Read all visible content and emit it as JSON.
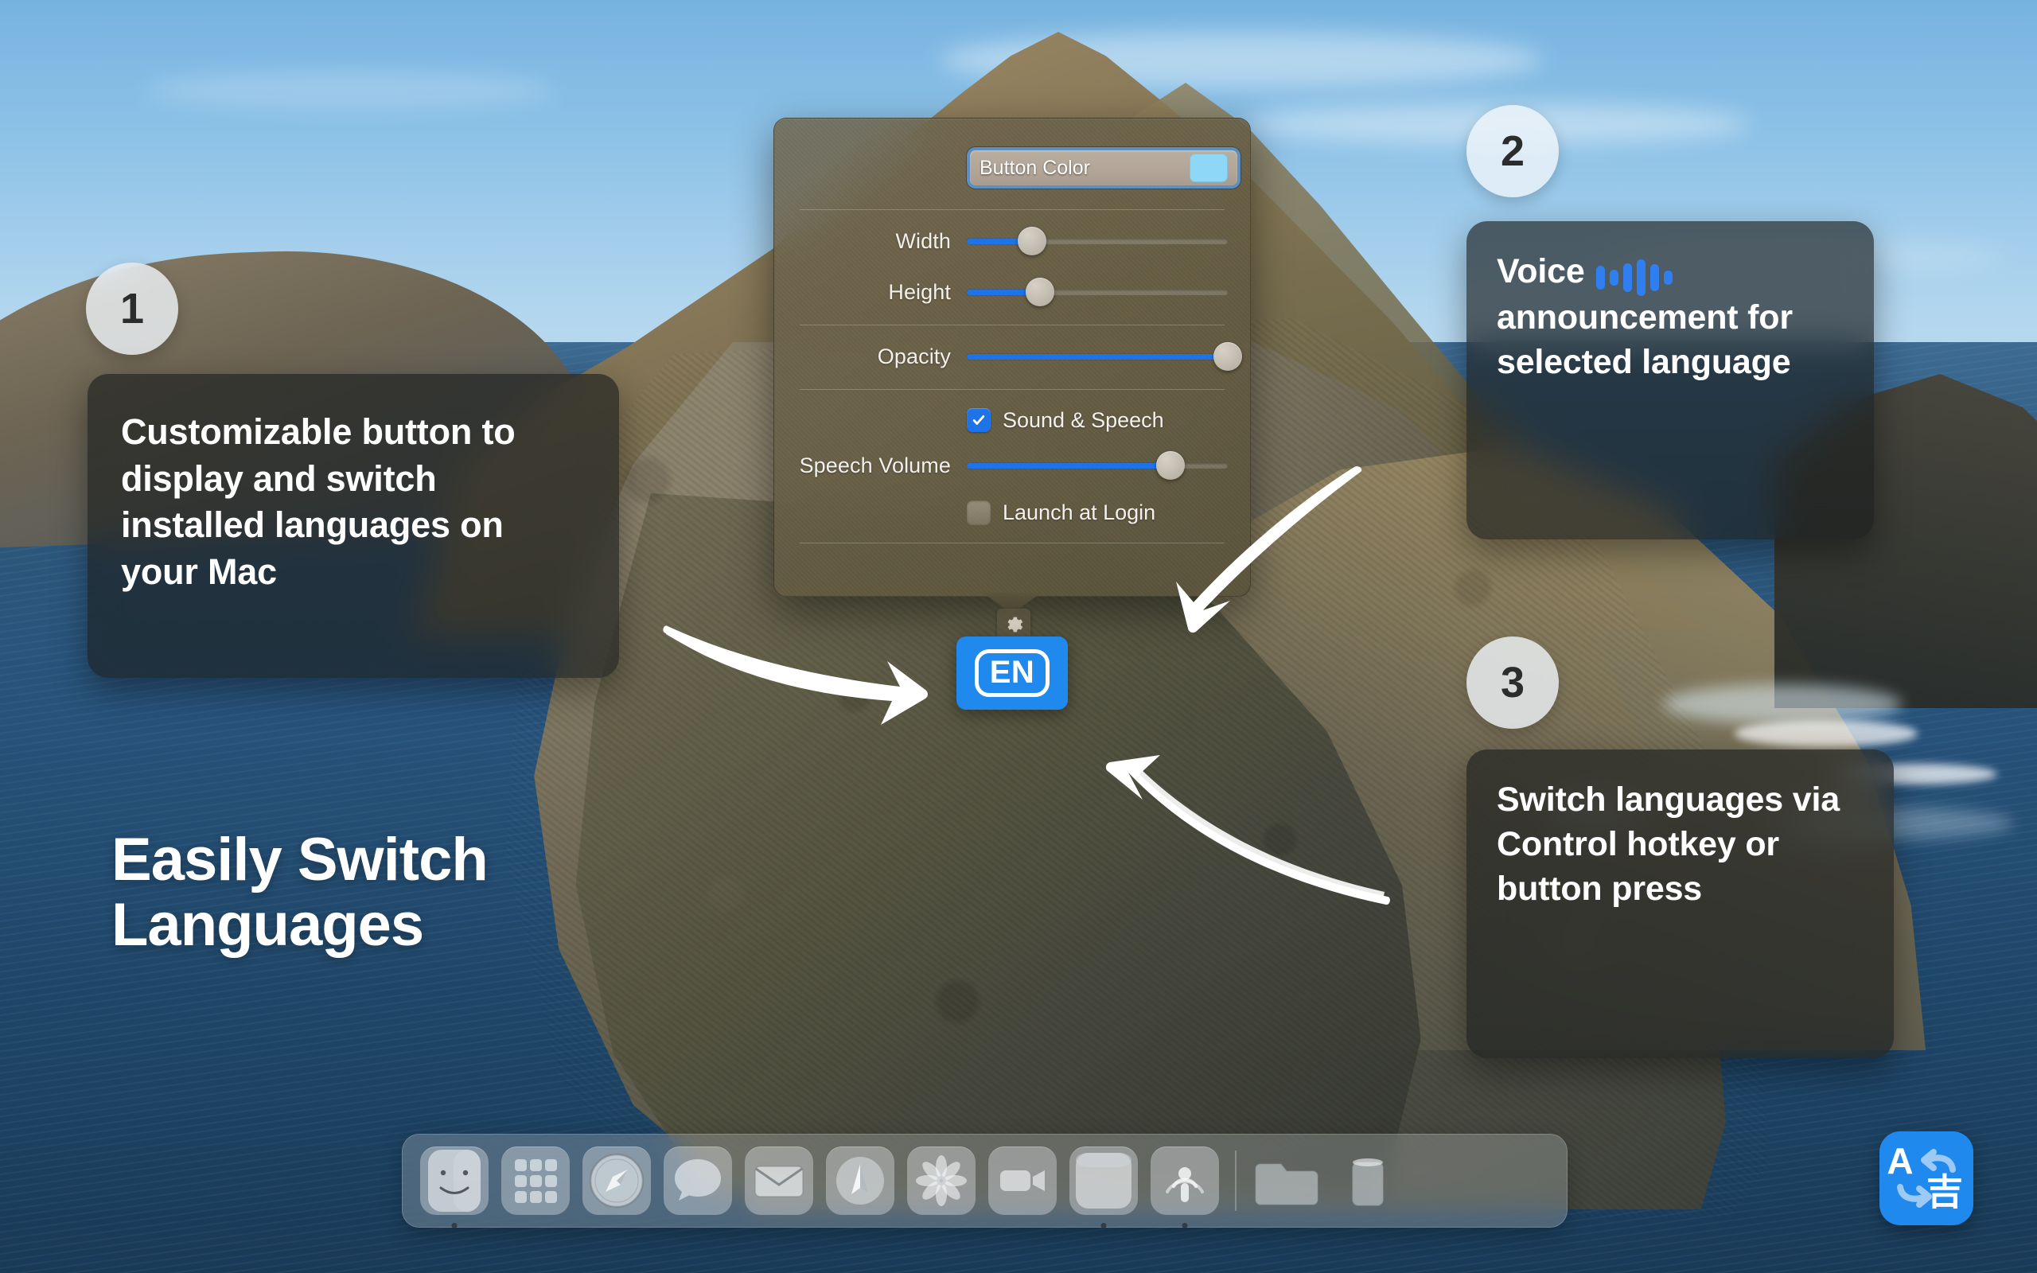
{
  "headline": {
    "line1": "Easily Switch",
    "line2": "Languages"
  },
  "settings_panel": {
    "color_row": {
      "label": "Button Color",
      "swatch_hex": "#8FD7F7",
      "focus_ring_hex": "#5B90C4"
    },
    "sliders": [
      {
        "label": "Width",
        "value_pct": 25
      },
      {
        "label": "Height",
        "value_pct": 28
      },
      {
        "label": "Opacity",
        "value_pct": 100
      },
      {
        "label": "Speech Volume",
        "value_pct": 78
      }
    ],
    "checkboxes": [
      {
        "label": "Sound & Speech",
        "checked": true
      },
      {
        "label": "Launch at Login",
        "checked": false
      }
    ],
    "gear_icon": "gear-icon",
    "accent_hex": "#1F73E8"
  },
  "menu_button": {
    "label": "EN",
    "background_hex": "#2089ED"
  },
  "app_icon": {
    "latin_glyph": "A",
    "cjk_glyph": "吉",
    "background_hex": "#2089ED"
  },
  "callouts": [
    {
      "number": "1",
      "text": "Customizable button to display and switch installed languages on your Mac"
    },
    {
      "number": "2",
      "text_before_icon": "Voice",
      "icon": "voice-waveform-icon",
      "text_after_icon": "announcement for selected language",
      "icon_hex": "#2F7FF0"
    },
    {
      "number": "3",
      "text": "Switch languages via Control hotkey or button press"
    }
  ],
  "arrows": [
    {
      "name": "arrow-to-en-button",
      "direction": "right"
    },
    {
      "name": "arrow-to-panel",
      "direction": "down-left"
    },
    {
      "name": "arrow-to-en-button-from-below",
      "direction": "up-left"
    }
  ],
  "dock": {
    "items": [
      {
        "name": "finder",
        "running": true
      },
      {
        "name": "launchpad",
        "running": false
      },
      {
        "name": "safari",
        "running": false
      },
      {
        "name": "messages",
        "running": false
      },
      {
        "name": "mail",
        "running": false
      },
      {
        "name": "maps",
        "running": false
      },
      {
        "name": "photos",
        "running": false
      },
      {
        "name": "facetime",
        "running": false
      },
      {
        "name": "calendar",
        "running": true
      },
      {
        "name": "podcasts",
        "running": true
      }
    ],
    "extras": [
      {
        "name": "downloads-folder"
      },
      {
        "name": "trash"
      }
    ]
  }
}
